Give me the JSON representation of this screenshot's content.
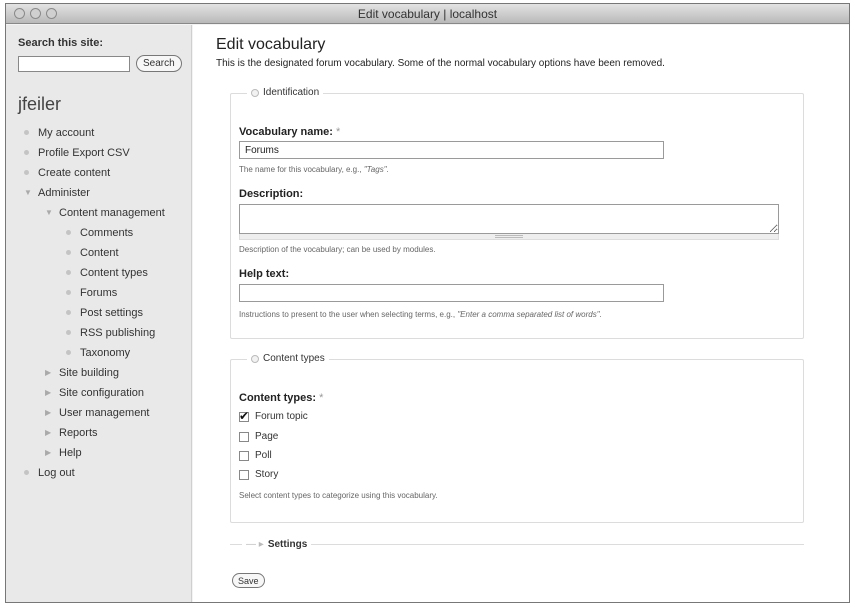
{
  "window": {
    "title": "Edit vocabulary | localhost"
  },
  "sidebar": {
    "search_label": "Search this site:",
    "search_value": "",
    "search_button": "Search",
    "username": "jfeiler",
    "menu": [
      {
        "label": "My account",
        "level": 0
      },
      {
        "label": "Profile Export CSV",
        "level": 0
      },
      {
        "label": "Create content",
        "level": 0
      },
      {
        "label": "Administer",
        "level": 0,
        "expanded": true
      },
      {
        "label": "Content management",
        "level": 1,
        "expanded": true
      },
      {
        "label": "Comments",
        "level": 2
      },
      {
        "label": "Content",
        "level": 2
      },
      {
        "label": "Content types",
        "level": 2
      },
      {
        "label": "Forums",
        "level": 2
      },
      {
        "label": "Post settings",
        "level": 2
      },
      {
        "label": "RSS publishing",
        "level": 2
      },
      {
        "label": "Taxonomy",
        "level": 2
      },
      {
        "label": "Site building",
        "level": 1
      },
      {
        "label": "Site configuration",
        "level": 1
      },
      {
        "label": "User management",
        "level": 1
      },
      {
        "label": "Reports",
        "level": 1
      },
      {
        "label": "Help",
        "level": 1
      },
      {
        "label": "Log out",
        "level": 0
      }
    ]
  },
  "main": {
    "title": "Edit vocabulary",
    "description": "This is the designated forum vocabulary. Some of the normal vocabulary options have been removed.",
    "identification": {
      "legend": "Identification",
      "name_label": "Vocabulary name:",
      "required_mark": "*",
      "name_value": "Forums",
      "name_help_prefix": "The name for this vocabulary, e.g., ",
      "name_help_example": "\"Tags\"",
      "name_help_suffix": ".",
      "description_label": "Description:",
      "description_value": "",
      "description_help": "Description of the vocabulary; can be used by modules.",
      "help_label": "Help text:",
      "help_value": "",
      "help_help_prefix": "Instructions to present to the user when selecting terms, e.g., ",
      "help_help_example": "\"Enter a comma separated list of words\"",
      "help_help_suffix": "."
    },
    "content_types": {
      "legend": "Content types",
      "label": "Content types:",
      "required_mark": "*",
      "options": [
        {
          "label": "Forum topic",
          "checked": true
        },
        {
          "label": "Page",
          "checked": false
        },
        {
          "label": "Poll",
          "checked": false
        },
        {
          "label": "Story",
          "checked": false
        }
      ],
      "help": "Select content types to categorize using this vocabulary."
    },
    "settings": {
      "legend": "Settings"
    },
    "save_button": "Save"
  }
}
